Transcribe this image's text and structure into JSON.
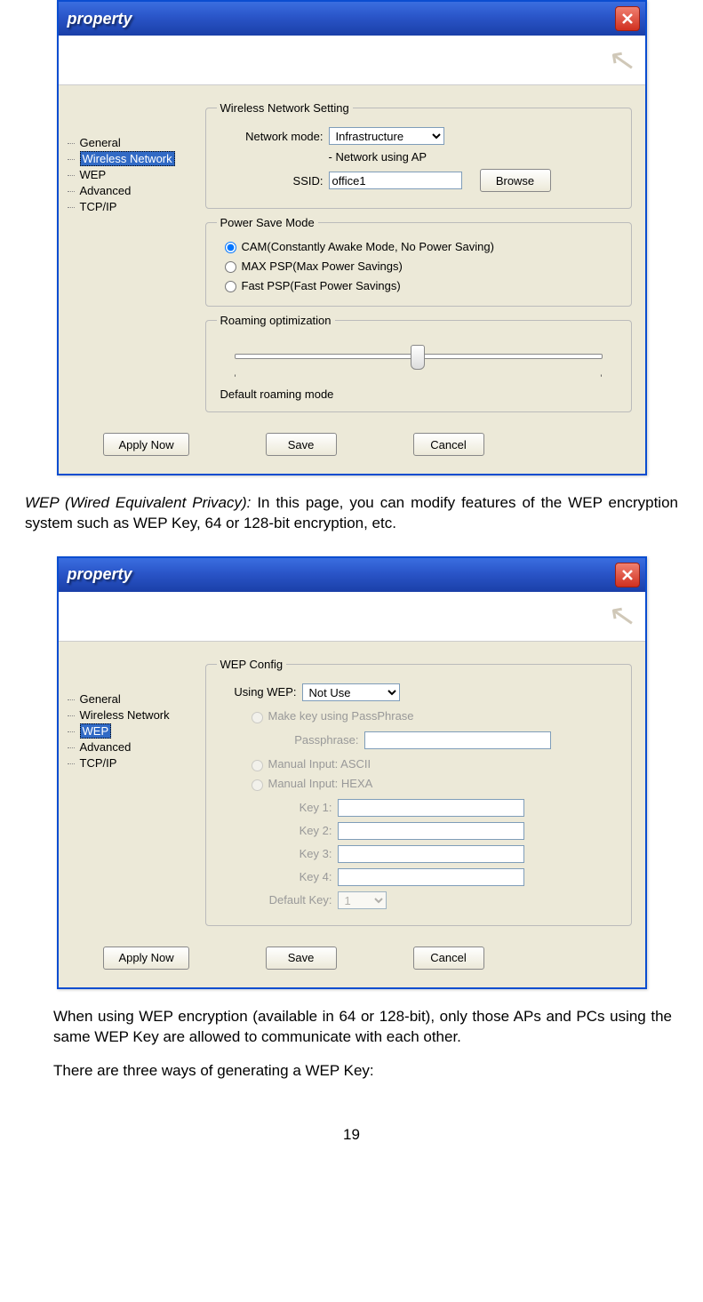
{
  "dialog1": {
    "title": "property",
    "tree": {
      "items": [
        "General",
        "Wireless Network",
        "WEP",
        "Advanced",
        "TCP/IP"
      ],
      "selected_index": 1
    },
    "wireless_setting": {
      "legend": "Wireless Network Setting",
      "network_mode_label": "Network mode:",
      "network_mode_value": "Infrastructure",
      "network_ap_note": "- Network using AP",
      "ssid_label": "SSID:",
      "ssid_value": "office1",
      "browse_label": "Browse"
    },
    "power_save": {
      "legend": "Power Save Mode",
      "options": [
        "CAM(Constantly Awake Mode, No Power Saving)",
        "MAX PSP(Max Power Savings)",
        "Fast PSP(Fast Power Savings)"
      ],
      "selected_index": 0
    },
    "roaming": {
      "legend": "Roaming optimization",
      "label": "Default roaming mode"
    },
    "buttons": {
      "apply": "Apply Now",
      "save": "Save",
      "cancel": "Cancel"
    }
  },
  "para1": "WEP (Wired Equivalent Privacy): In this page, you can modify features of the WEP encryption system such as WEP Key, 64 or 128-bit encryption, etc.",
  "dialog2": {
    "title": "property",
    "tree": {
      "items": [
        "General",
        "Wireless Network",
        "WEP",
        "Advanced",
        "TCP/IP"
      ],
      "selected_index": 2
    },
    "wep_config": {
      "legend": "WEP Config",
      "using_wep_label": "Using WEP:",
      "using_wep_value": "Not Use",
      "make_key_label": "Make key using PassPhrase",
      "passphrase_label": "Passphrase:",
      "manual_ascii_label": "Manual Input:  ASCII",
      "manual_hexa_label": "Manual Input:  HEXA",
      "key1_label": "Key 1:",
      "key2_label": "Key 2:",
      "key3_label": "Key 3:",
      "key4_label": "Key 4:",
      "default_key_label": "Default Key:",
      "default_key_value": "1"
    },
    "buttons": {
      "apply": "Apply Now",
      "save": "Save",
      "cancel": "Cancel"
    }
  },
  "para2": "When using WEP encryption (available in 64 or 128-bit), only those APs and PCs using the same WEP Key are allowed to communicate with each other.",
  "para3": "There are three ways of generating a WEP Key:",
  "page_number": "19"
}
